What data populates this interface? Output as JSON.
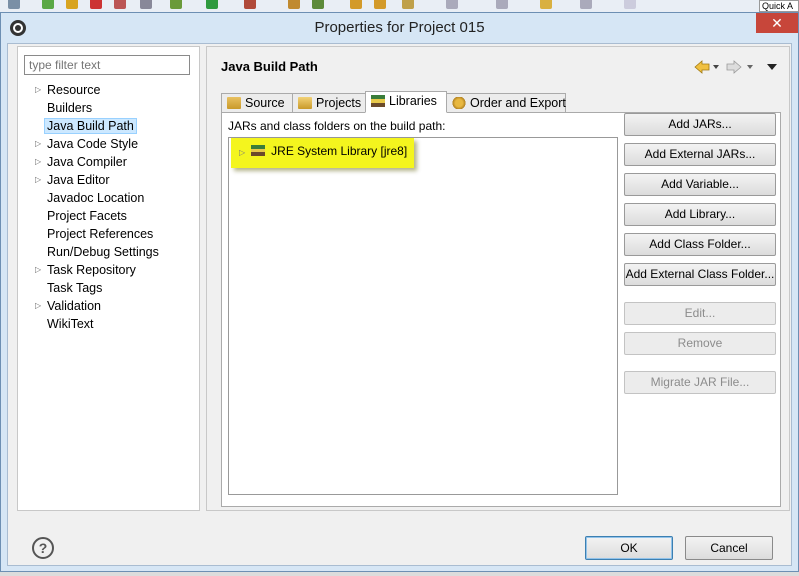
{
  "toolbar": {
    "quick_access": "Quick A"
  },
  "dialog": {
    "title": "Properties for Project 015",
    "close_label": "✕"
  },
  "filter": {
    "placeholder": "type filter text"
  },
  "nav_tree": [
    {
      "label": "Resource",
      "expandable": true
    },
    {
      "label": "Builders",
      "expandable": false
    },
    {
      "label": "Java Build Path",
      "expandable": false,
      "selected": true
    },
    {
      "label": "Java Code Style",
      "expandable": true
    },
    {
      "label": "Java Compiler",
      "expandable": true
    },
    {
      "label": "Java Editor",
      "expandable": true
    },
    {
      "label": "Javadoc Location",
      "expandable": false
    },
    {
      "label": "Project Facets",
      "expandable": false
    },
    {
      "label": "Project References",
      "expandable": false
    },
    {
      "label": "Run/Debug Settings",
      "expandable": false
    },
    {
      "label": "Task Repository",
      "expandable": true
    },
    {
      "label": "Task Tags",
      "expandable": false
    },
    {
      "label": "Validation",
      "expandable": true
    },
    {
      "label": "WikiText",
      "expandable": false
    }
  ],
  "page": {
    "title": "Java Build Path",
    "tabs": [
      {
        "label": "Source",
        "icon": "source-folder-icon"
      },
      {
        "label": "Projects",
        "icon": "projects-folder-icon"
      },
      {
        "label": "Libraries",
        "icon": "library-icon",
        "active": true
      },
      {
        "label": "Order and Export",
        "icon": "order-export-icon"
      }
    ],
    "list_caption": "JARs and class folders on the build path:",
    "libraries": [
      {
        "label": "JRE System Library [jre8]",
        "icon": "library-icon"
      }
    ],
    "buttons": [
      {
        "label": "Add JARs...",
        "enabled": true
      },
      {
        "label": "Add External JARs...",
        "enabled": true
      },
      {
        "label": "Add Variable...",
        "enabled": true
      },
      {
        "label": "Add Library...",
        "enabled": true
      },
      {
        "label": "Add Class Folder...",
        "enabled": true
      },
      {
        "label": "Add External Class Folder...",
        "enabled": true
      },
      {
        "label": "Edit...",
        "enabled": false
      },
      {
        "label": "Remove",
        "enabled": false
      },
      {
        "label": "Migrate JAR File...",
        "enabled": false
      }
    ]
  },
  "footer": {
    "help_label": "?",
    "ok_label": "OK",
    "cancel_label": "Cancel"
  },
  "colors": {
    "highlight": "#f4f51e",
    "selection": "#cce8ff",
    "close": "#c7463a"
  }
}
